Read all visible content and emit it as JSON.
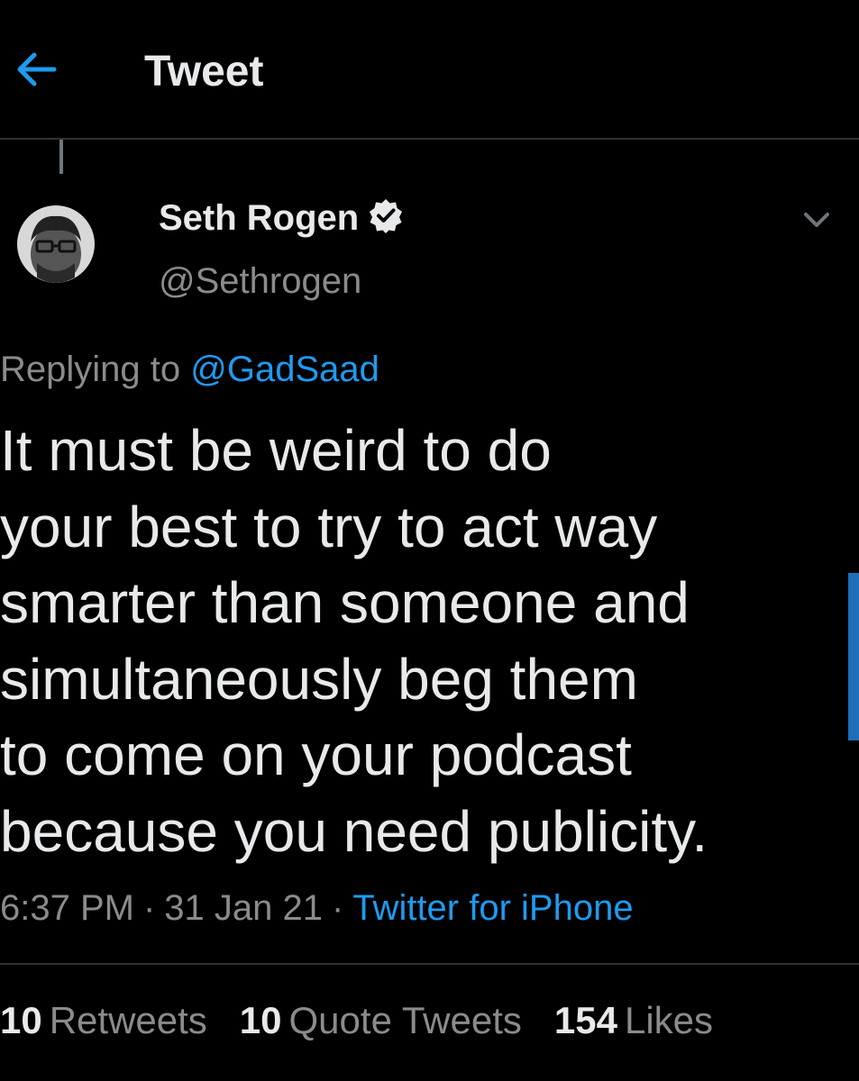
{
  "header": {
    "back_icon": "arrow-left-icon",
    "title": "Tweet"
  },
  "author": {
    "display_name": "Seth Rogen",
    "verified_icon": "verified-badge-icon",
    "handle": "@Sethrogen",
    "more_icon": "chevron-down-icon"
  },
  "reply": {
    "prefix": "Replying to",
    "mention": "@GadSaad"
  },
  "tweet": {
    "lines": [
      "It must be weird to do",
      "your best to try to act way",
      "smarter than someone and",
      "simultaneously beg them",
      "to come on your podcast",
      "because you need publicity."
    ]
  },
  "meta": {
    "time": "6:37 PM",
    "separator": "·",
    "date": "31 Jan 21",
    "source": "Twitter for iPhone"
  },
  "stats": {
    "retweets_count": "10",
    "retweets_label": "Retweets",
    "quotes_count": "10",
    "quotes_label": "Quote Tweets",
    "likes_count": "154",
    "likes_label": "Likes"
  },
  "colors": {
    "background": "#000000",
    "text": "#e7e9ea",
    "muted": "#8b8b8b",
    "accent": "#1d9bf0",
    "divider": "#2f3336"
  }
}
